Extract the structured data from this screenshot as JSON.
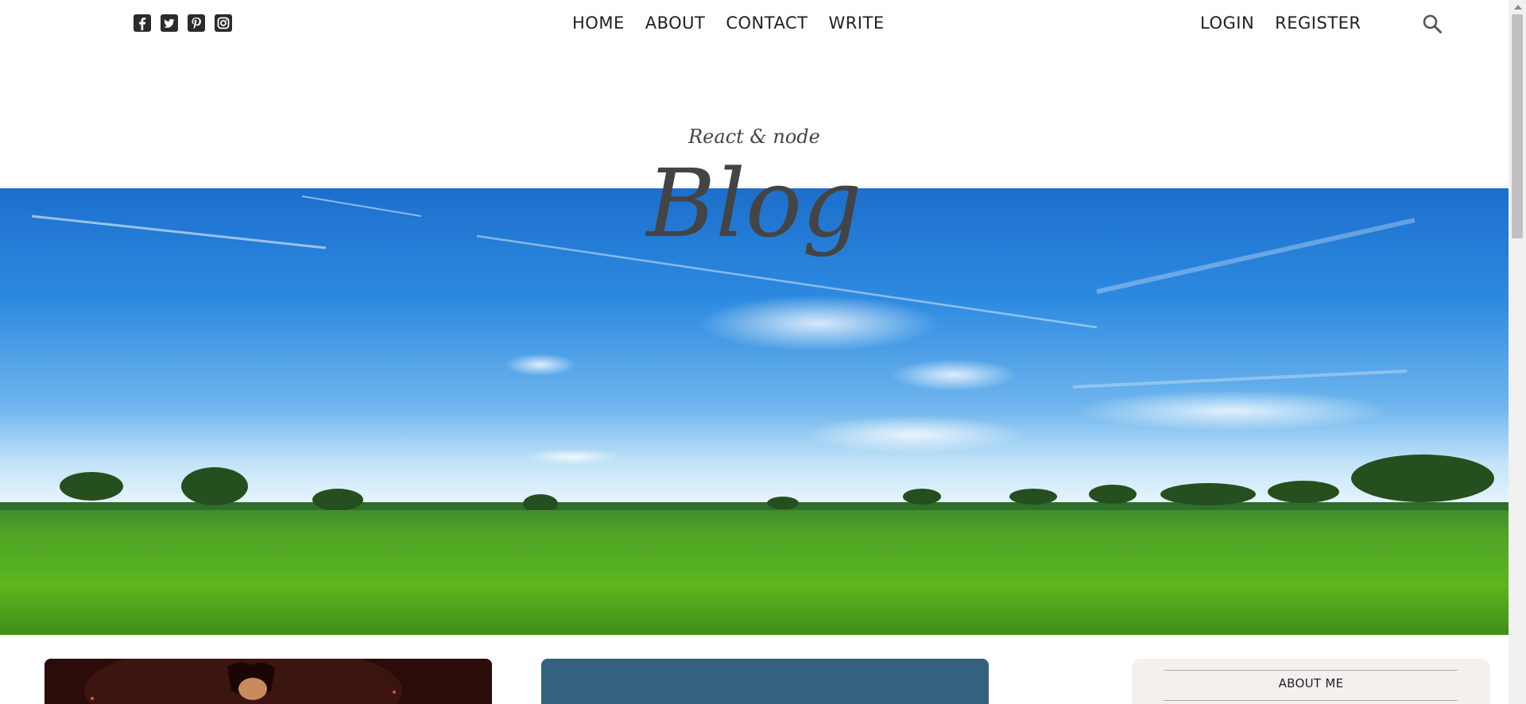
{
  "social": {
    "icons": [
      "facebook-icon",
      "twitter-icon",
      "pinterest-icon",
      "instagram-icon"
    ]
  },
  "nav": {
    "center": [
      "HOME",
      "ABOUT",
      "CONTACT",
      "WRITE"
    ],
    "right": [
      "LOGIN",
      "REGISTER"
    ],
    "search_icon": "search-icon"
  },
  "header": {
    "title_small": "React & node",
    "title_large": "Blog"
  },
  "sidebar": {
    "title": "ABOUT ME"
  },
  "colors": {
    "text": "#444444",
    "nav_text": "#1f1f1f",
    "sidebar_bg": "#f4f0ee",
    "card_blue": "#34617f"
  }
}
